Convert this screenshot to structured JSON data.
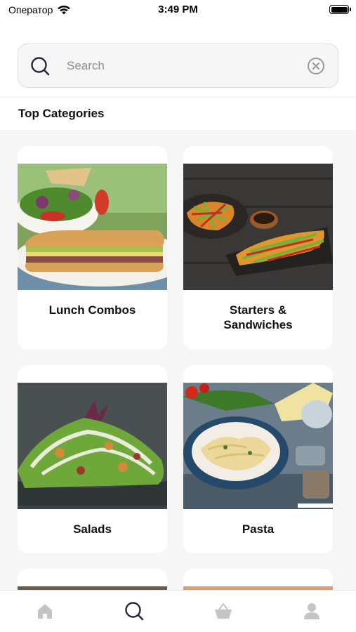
{
  "status_bar": {
    "carrier": "Оператор",
    "time": "3:49 PM"
  },
  "search": {
    "placeholder": "Search",
    "value": ""
  },
  "section": {
    "title": "Top Categories"
  },
  "categories": [
    {
      "label": "Lunch Combos"
    },
    {
      "label": "Starters &\nSandwiches"
    },
    {
      "label": "Salads"
    },
    {
      "label": "Pasta"
    }
  ],
  "tab_bar": {
    "items": [
      {
        "icon": "home-icon",
        "active": false
      },
      {
        "icon": "search-icon",
        "active": true
      },
      {
        "icon": "basket-icon",
        "active": false
      },
      {
        "icon": "profile-icon",
        "active": false
      }
    ],
    "active_color": "#2b2440",
    "inactive_color": "#c4c4c4"
  }
}
